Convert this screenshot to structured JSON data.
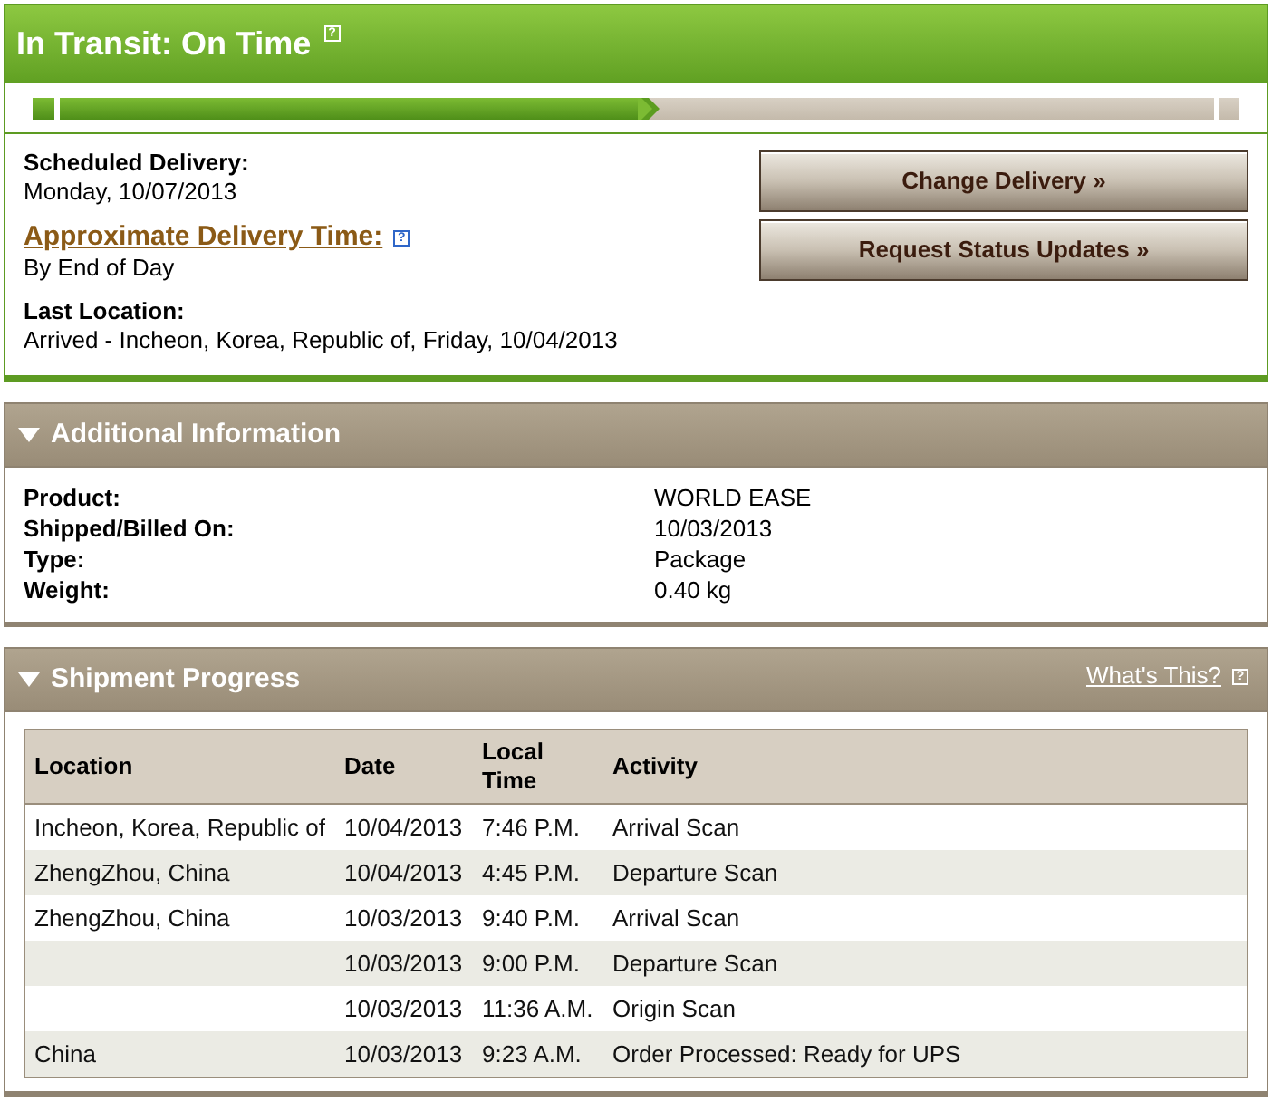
{
  "tracking_status": {
    "title": "In Transit: On Time",
    "help_icon": "?",
    "progress": {
      "level": 0.5
    }
  },
  "delivery_details": [
    {
      "kind": "plain",
      "label": "Scheduled Delivery:",
      "value": "Monday, 10/07/2013"
    },
    {
      "kind": "link",
      "label": "Approximate Delivery Time:",
      "help_icon": "?",
      "value": "By End of Day"
    },
    {
      "kind": "plain",
      "label": "Last Location:",
      "value": "Arrived - Incheon, Korea, Republic of, Friday, 10/04/2013"
    }
  ],
  "actions": [
    "Change Delivery »",
    "Request Status Updates »"
  ],
  "additional_information": {
    "title": "Additional Information",
    "expanded": true,
    "rows": [
      {
        "label": "Product:",
        "value": "WORLD EASE"
      },
      {
        "label": "Shipped/Billed On:",
        "value": "10/03/2013"
      },
      {
        "label": "Type:",
        "value": "Package"
      },
      {
        "label": "Weight:",
        "value": "0.40 kg"
      }
    ]
  },
  "shipment_progress": {
    "title": "Shipment Progress",
    "expanded": true,
    "help_link": {
      "label": "What's This?",
      "help_icon": "?"
    },
    "table": {
      "columns": [
        "Location",
        "Date",
        "Local Time",
        "Activity"
      ],
      "rows": [
        {
          "location": "Incheon, Korea, Republic of",
          "date": "10/04/2013",
          "local_time": "7:46 P.M.",
          "activity": "Arrival Scan"
        },
        {
          "location": "ZhengZhou, China",
          "date": "10/04/2013",
          "local_time": "4:45 P.M.",
          "activity": "Departure Scan"
        },
        {
          "location": "ZhengZhou, China",
          "date": "10/03/2013",
          "local_time": "9:40 P.M.",
          "activity": "Arrival Scan"
        },
        {
          "date": "10/03/2013",
          "local_time": "9:00 P.M.",
          "activity": "Departure Scan"
        },
        {
          "date": "10/03/2013",
          "local_time": "11:36 A.M.",
          "activity": "Origin Scan"
        },
        {
          "location": "China",
          "date": "10/03/2013",
          "local_time": "9:23 A.M.",
          "activity": "Order Processed: Ready for UPS"
        }
      ]
    }
  }
}
